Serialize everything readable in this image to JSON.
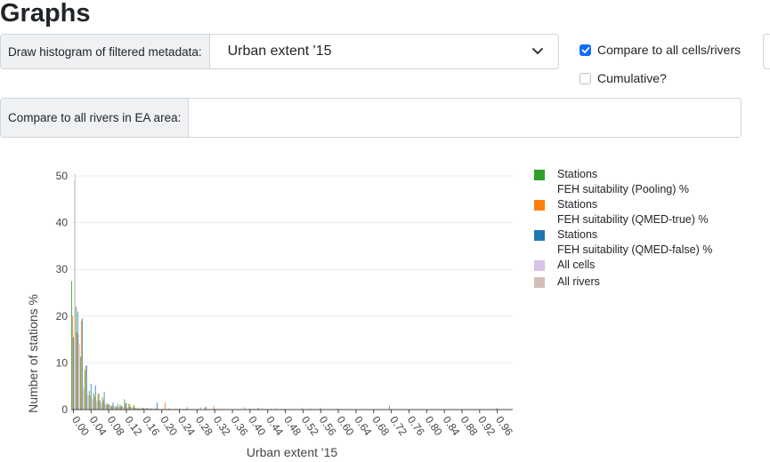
{
  "header": {
    "title": "Graphs"
  },
  "histogram_control": {
    "label": "Draw histogram of filtered metadata:",
    "selected": "Urban extent '15"
  },
  "compare_all": {
    "label": "Compare to all cells/rivers",
    "checked": true
  },
  "cumulative": {
    "label": "Cumulative?",
    "checked": false
  },
  "ea_area": {
    "label": "Compare to all rivers in EA area:",
    "value": ""
  },
  "icons": {
    "dropdown": "chevron-down-icon",
    "check": "check-icon"
  },
  "colors": {
    "accent": "#0d6efd",
    "pooling": "#2ca02c",
    "qmed_true": "#ff7f0e",
    "qmed_false": "#1f77b4",
    "all_cells": "#d6c4e6",
    "all_rivers": "#d2bfb8"
  },
  "chart_data": {
    "type": "bar",
    "xlabel": "Urban extent '15",
    "ylabel": "Number of stations %",
    "ylim": [
      0,
      50
    ],
    "yticks": [
      0,
      10,
      20,
      30,
      40,
      50
    ],
    "xlim": [
      0,
      1
    ],
    "bin_width": 0.01,
    "x": [
      0,
      0.01,
      0.02,
      0.03,
      0.04,
      0.05,
      0.06,
      0.07,
      0.08,
      0.09,
      0.1,
      0.11,
      0.12,
      0.13,
      0.14,
      0.15,
      0.16,
      0.17,
      0.18,
      0.19,
      0.2,
      0.21,
      0.22,
      0.23,
      0.24,
      0.25,
      0.26,
      0.27,
      0.28,
      0.29,
      0.3,
      0.31,
      0.32,
      0.33,
      0.34,
      0.35,
      0.36,
      0.37,
      0.38,
      0.39,
      0.4,
      0.41,
      0.42,
      0.43,
      0.44,
      0.45,
      0.46,
      0.47,
      0.48,
      0.49,
      0.5,
      0.51,
      0.52,
      0.53,
      0.54,
      0.55,
      0.56,
      0.57,
      0.58,
      0.59,
      0.6,
      0.61,
      0.62,
      0.63,
      0.64,
      0.65,
      0.66,
      0.67,
      0.68,
      0.69,
      0.7,
      0.71,
      0.72,
      0.73,
      0.74,
      0.75,
      0.76,
      0.77,
      0.78,
      0.79,
      0.8,
      0.81,
      0.82,
      0.83,
      0.84,
      0.85,
      0.86,
      0.87,
      0.88,
      0.89,
      0.9,
      0.91,
      0.92,
      0.93,
      0.94,
      0.95,
      0.96,
      0.97,
      0.98,
      0.99
    ],
    "x_tick_labels": [
      "0.00",
      "0.04",
      "0.08",
      "0.12",
      "0.16",
      "0.20",
      "0.24",
      "0.28",
      "0.32",
      "0.36",
      "0.40",
      "0.44",
      "0.48",
      "0.52",
      "0.56",
      "0.60",
      "0.64",
      "0.68",
      "0.72",
      "0.76",
      "0.80",
      "0.84",
      "0.88",
      "0.92",
      "0.96"
    ],
    "legend_position": "top-right",
    "series": [
      {
        "name": "Stations FEH suitability (Pooling) %",
        "name_lines": [
          "Stations",
          "FEH suitability (Pooling) %"
        ],
        "color": "#2ca02c",
        "values": [
          27.5,
          22,
          11.3,
          8.5,
          4,
          3.5,
          3.3,
          2.6,
          1.4,
          0.8,
          0.6,
          1.1,
          2.2,
          1.2,
          0.8,
          0.3,
          0.4,
          0.3,
          0.2,
          0.2,
          0,
          0,
          0.2,
          0,
          0,
          0,
          0.2,
          0,
          0,
          0,
          0,
          0,
          0,
          0,
          0,
          0,
          0,
          0,
          0,
          0,
          0,
          0,
          0,
          0,
          0,
          0,
          0,
          0,
          0,
          0,
          0,
          0,
          0,
          0,
          0,
          0,
          0,
          0,
          0,
          0,
          0,
          0,
          0,
          0,
          0,
          0,
          0,
          0,
          0,
          0,
          0,
          0,
          0.8,
          0,
          0,
          0,
          0,
          0,
          0,
          0,
          0,
          0,
          0,
          0,
          0,
          0,
          0,
          0,
          0,
          0,
          0,
          0,
          0,
          0,
          0,
          0,
          0,
          0,
          0,
          0
        ]
      },
      {
        "name": "Stations FEH suitability (QMED-true) %",
        "name_lines": [
          "Stations",
          "FEH suitability (QMED-true) %"
        ],
        "color": "#ff7f0e",
        "values": [
          20,
          16.5,
          19,
          9.3,
          3,
          2.8,
          3.5,
          2,
          1,
          0.8,
          0.5,
          0.7,
          1.2,
          1.2,
          1,
          0.3,
          0.3,
          0.3,
          0.3,
          0.2,
          0,
          1.5,
          0.2,
          0.2,
          0,
          0,
          0.6,
          0,
          0,
          0.5,
          0.5,
          0,
          0.8,
          0.2,
          0,
          0,
          0,
          0,
          0,
          0.5,
          0,
          0.2,
          0.3,
          0.3,
          0,
          0.2,
          0.3,
          0,
          0.2,
          0,
          0,
          0,
          0.3,
          0,
          0.2,
          0,
          0,
          0,
          0,
          0,
          0.2,
          0,
          0,
          0,
          0,
          0,
          0,
          0,
          0,
          0,
          0,
          0,
          0,
          0,
          0,
          0,
          0,
          0,
          0,
          0,
          0,
          0,
          0,
          0,
          0,
          0,
          0,
          0,
          0,
          0,
          0,
          0,
          0,
          0,
          0,
          0,
          0,
          0,
          0,
          0
        ]
      },
      {
        "name": "Stations FEH suitability (QMED-false) %",
        "name_lines": [
          "Stations",
          "FEH suitability (QMED-false) %"
        ],
        "color": "#1f77b4",
        "values": [
          15.5,
          21,
          19.5,
          9.5,
          5.5,
          5.2,
          2,
          3.8,
          1.2,
          1.5,
          1.2,
          0.8,
          1.5,
          0.6,
          0.4,
          0.2,
          0.3,
          0.2,
          0,
          1.5,
          0,
          0,
          0,
          0,
          0.2,
          0,
          0,
          0,
          0,
          0,
          0.6,
          0,
          0.2,
          0,
          0,
          0,
          0,
          0,
          0,
          0,
          0.2,
          0,
          0.3,
          0,
          0,
          0,
          0,
          0,
          0,
          0,
          0,
          0,
          0,
          0,
          0,
          0,
          0.3,
          0,
          0,
          0,
          0,
          0,
          0,
          0,
          0,
          0,
          0,
          0,
          0,
          0,
          0,
          0,
          0,
          0,
          0,
          0,
          0,
          0,
          0,
          0,
          0,
          0,
          0,
          0,
          0,
          0,
          0,
          0,
          0,
          0,
          0,
          0,
          0,
          0,
          0,
          0,
          0.3,
          0,
          0,
          0
        ]
      },
      {
        "name": "All cells",
        "color": "#d6c4e6",
        "values": [
          49,
          16,
          5,
          3.5,
          2.5,
          2,
          1.5,
          1.2,
          1,
          0.8,
          0.7,
          0.6,
          0.5,
          0.45,
          0.4,
          0.35,
          0.3,
          0.3,
          0.25,
          0.25,
          0.2,
          0.2,
          0.2,
          0.2,
          0.15,
          0.15,
          0.15,
          0.15,
          0.1,
          0.1,
          0.1,
          0.1,
          0.1,
          0.1,
          0.1,
          0.1,
          0.1,
          0.1,
          0.08,
          0.08,
          0.08,
          0.08,
          0.08,
          0.08,
          0.08,
          0.08,
          0.08,
          0.08,
          0.08,
          0.08,
          0.06,
          0.06,
          0.06,
          0.06,
          0.06,
          0.06,
          0.06,
          0.06,
          0.06,
          0.06,
          0.05,
          0.05,
          0.05,
          0.05,
          0.05,
          0.05,
          0.05,
          0.05,
          0.05,
          0.05,
          0.05,
          0.05,
          0.05,
          0.05,
          0.05,
          0.05,
          0.05,
          0.05,
          0.05,
          0.05,
          0.05,
          0.05,
          0.05,
          0.05,
          0.05,
          0.05,
          0.05,
          0.05,
          0.05,
          0.05,
          0.05,
          0.05,
          0.05,
          0.05,
          0.05,
          0.05,
          0.05,
          0.05,
          0.05,
          0.05
        ]
      },
      {
        "name": "All rivers",
        "color": "#d2bfb8",
        "values": [
          50.5,
          14,
          4.5,
          3,
          2,
          1.8,
          1.3,
          1,
          0.9,
          0.7,
          0.6,
          0.5,
          0.45,
          0.4,
          0.35,
          0.3,
          0.3,
          0.25,
          0.25,
          0.2,
          0.2,
          0.2,
          0.15,
          0.15,
          0.15,
          0.15,
          0.1,
          0.1,
          0.1,
          0.1,
          0.1,
          0.1,
          0.1,
          0.1,
          0.1,
          0.08,
          0.08,
          0.08,
          0.08,
          0.08,
          0.08,
          0.08,
          0.08,
          0.08,
          0.06,
          0.06,
          0.06,
          0.06,
          0.06,
          0.06,
          0.06,
          0.06,
          0.06,
          0.05,
          0.05,
          0.05,
          0.05,
          0.05,
          0.05,
          0.05,
          0.05,
          0.05,
          0.05,
          0.05,
          0.05,
          0.05,
          0.05,
          0.05,
          0.05,
          0.05,
          0.05,
          0.05,
          0.05,
          0.05,
          0.05,
          0.05,
          0.05,
          0.05,
          0.05,
          0.05,
          0.05,
          0.05,
          0.05,
          0.05,
          0.05,
          0.05,
          0.05,
          0.05,
          0.05,
          0.05,
          0.05,
          0.05,
          0.05,
          0.05,
          0.05,
          0.05,
          0.05,
          0.05,
          0.05,
          0.05
        ]
      }
    ]
  }
}
